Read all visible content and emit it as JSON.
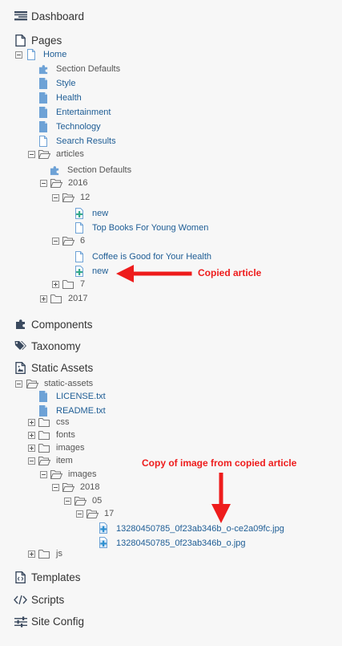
{
  "sections": {
    "dashboard": "Dashboard",
    "pages": "Pages",
    "components": "Components",
    "taxonomy": "Taxonomy",
    "static_assets": "Static Assets",
    "templates": "Templates",
    "scripts": "Scripts",
    "site_config": "Site Config"
  },
  "pages_tree": {
    "home": "Home",
    "section_defaults": "Section Defaults",
    "style": "Style",
    "health": "Health",
    "entertainment": "Entertainment",
    "technology": "Technology",
    "search_results": "Search Results",
    "articles": "articles",
    "articles_section_defaults": "Section Defaults",
    "year_2016": "2016",
    "month_12": "12",
    "new_1": "new",
    "top_books": "Top Books For Young Women",
    "month_6": "6",
    "coffee": "Coffee is Good for Your Health",
    "new_2": "new",
    "month_7": "7",
    "year_2017": "2017"
  },
  "assets_tree": {
    "static_assets_folder": "static-assets",
    "license": "LICENSE.txt",
    "readme": "README.txt",
    "css": "css",
    "fonts": "fonts",
    "images": "images",
    "item": "item",
    "item_images": "images",
    "year_2018": "2018",
    "month_05": "05",
    "day_17": "17",
    "image_1": "13280450785_0f23ab346b_o-ce2a09fc.jpg",
    "image_2": "13280450785_0f23ab346b_o.jpg",
    "js": "js"
  },
  "annotations": {
    "copied_article": "Copied article",
    "copy_of_image": "Copy of image from copied article"
  },
  "colors": {
    "link": "#1e5d95",
    "icon_blue": "#6ea2d6",
    "annotation_red": "#ee1c1c"
  }
}
